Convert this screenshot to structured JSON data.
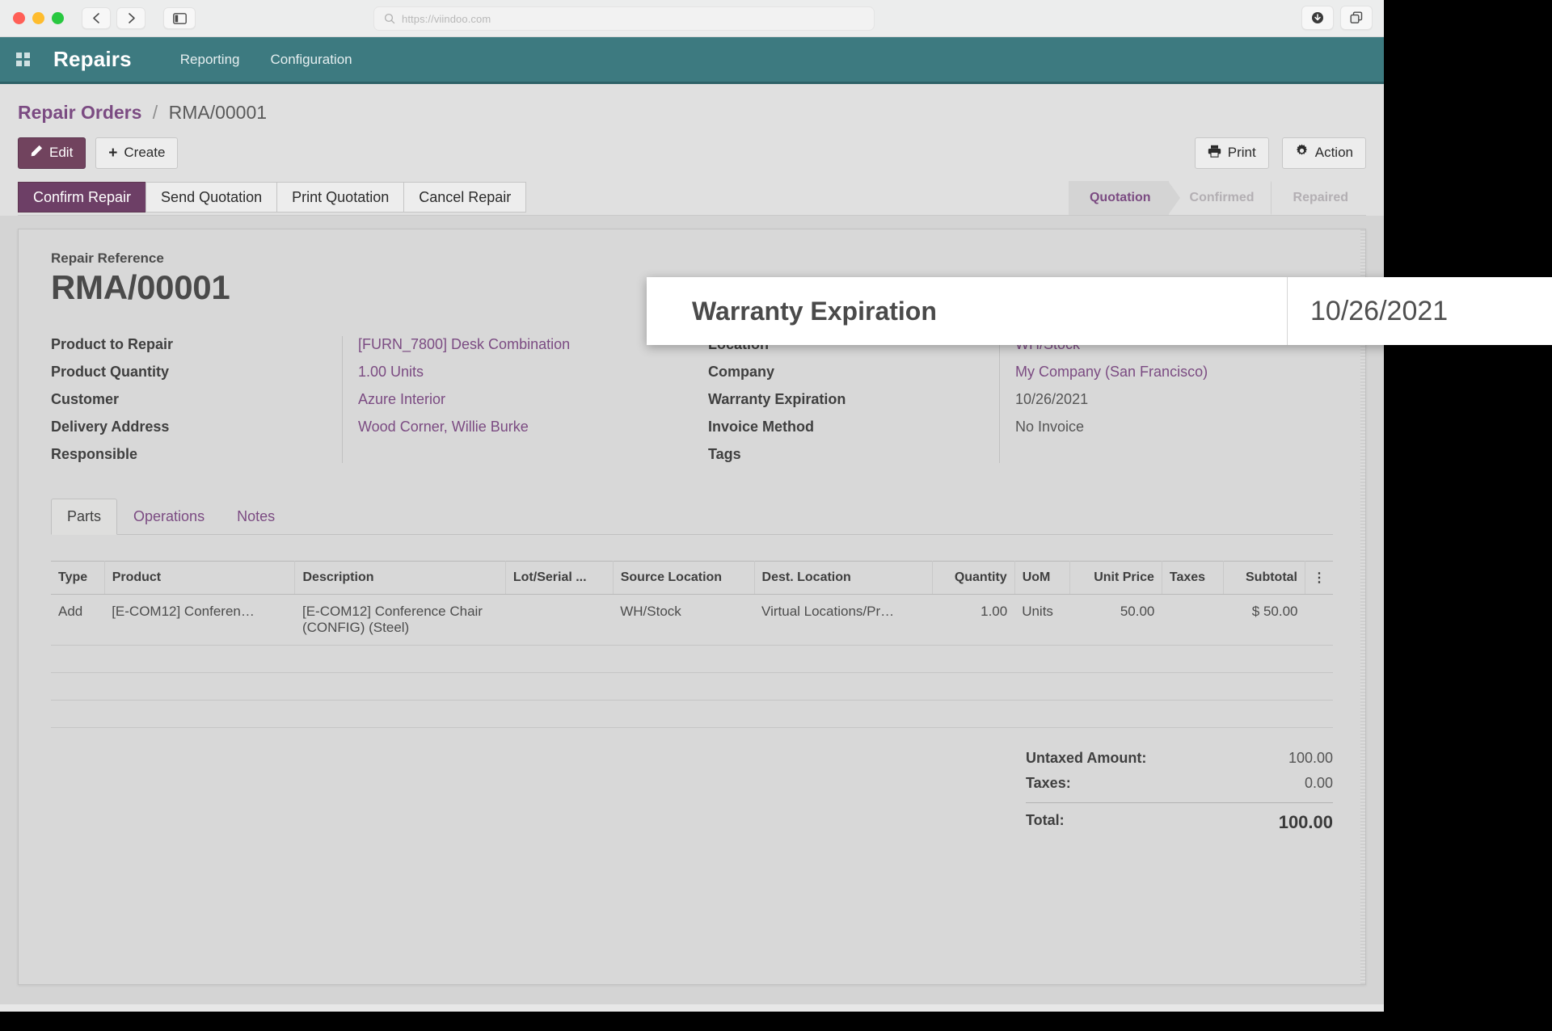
{
  "browser": {
    "url": "https://viindoo.com",
    "search_icon": "search-icon",
    "back_icon": "‹",
    "forward_icon": "›",
    "sidebar_icon": "sidebar-icon",
    "download_icon": "download-icon",
    "tabs_icon": "duplicate-tabs-icon"
  },
  "navbar": {
    "brand": "Repairs",
    "apps_icon": "apps-grid-icon",
    "menu": [
      {
        "label": "Reporting"
      },
      {
        "label": "Configuration"
      }
    ]
  },
  "control_panel": {
    "breadcrumb_root": "Repair Orders",
    "breadcrumb_sep": "/",
    "breadcrumb_current": "RMA/00001",
    "edit_label": "Edit",
    "edit_icon": "pencil-icon",
    "create_label": "Create",
    "create_icon": "plus-icon",
    "print_label": "Print",
    "print_icon": "printer-icon",
    "action_label": "Action",
    "action_icon": "gear-icon"
  },
  "statusbar": {
    "buttons": [
      {
        "label": "Confirm Repair",
        "active": true
      },
      {
        "label": "Send Quotation",
        "active": false
      },
      {
        "label": "Print Quotation",
        "active": false
      },
      {
        "label": "Cancel Repair",
        "active": false
      }
    ],
    "stages": [
      {
        "label": "Quotation",
        "active": true
      },
      {
        "label": "Confirmed",
        "active": false
      },
      {
        "label": "Repaired",
        "active": false
      }
    ]
  },
  "form": {
    "reference_label": "Repair Reference",
    "reference_value": "RMA/00001",
    "left_fields": [
      {
        "label": "Product to Repair",
        "value": "[FURN_7800] Desk Combination",
        "link": true
      },
      {
        "label": "Product Quantity",
        "value": "1.00 Units",
        "link": true
      },
      {
        "label": "Customer",
        "value": "Azure Interior",
        "link": true
      },
      {
        "label": "Delivery Address",
        "value": "Wood Corner, Willie Burke",
        "link": true
      },
      {
        "label": "Responsible",
        "value": "",
        "link": false
      }
    ],
    "right_fields": [
      {
        "label": "Location",
        "value": "WH/Stock",
        "link": true
      },
      {
        "label": "Company",
        "value": "My Company (San Francisco)",
        "link": true
      },
      {
        "label": "Warranty Expiration",
        "value": "10/26/2021",
        "link": false
      },
      {
        "label": "Invoice Method",
        "value": "No Invoice",
        "link": false
      },
      {
        "label": "Tags",
        "value": "",
        "link": false
      }
    ]
  },
  "notebook": {
    "tabs": [
      {
        "label": "Parts",
        "active": true
      },
      {
        "label": "Operations",
        "active": false
      },
      {
        "label": "Notes",
        "active": false
      }
    ]
  },
  "lines_table": {
    "columns": [
      {
        "label": "Type",
        "align": "left"
      },
      {
        "label": "Product",
        "align": "left"
      },
      {
        "label": "Description",
        "align": "left"
      },
      {
        "label": "Lot/Serial ...",
        "align": "left"
      },
      {
        "label": "Source Location",
        "align": "left"
      },
      {
        "label": "Dest. Location",
        "align": "left"
      },
      {
        "label": "Quantity",
        "align": "right"
      },
      {
        "label": "UoM",
        "align": "left"
      },
      {
        "label": "Unit Price",
        "align": "right"
      },
      {
        "label": "Taxes",
        "align": "left"
      },
      {
        "label": "Subtotal",
        "align": "right"
      }
    ],
    "options_icon": "vertical-dots-icon",
    "rows": [
      {
        "type": "Add",
        "product": "[E-COM12] Conferen…",
        "description": "[E-COM12] Conference Chair (CONFIG) (Steel)",
        "lot_serial": "",
        "source_location": "WH/Stock",
        "dest_location": "Virtual Locations/Pr…",
        "quantity": "1.00",
        "uom": "Units",
        "unit_price": "50.00",
        "taxes": "",
        "subtotal": "$ 50.00"
      }
    ]
  },
  "totals": {
    "untaxed_label": "Untaxed Amount:",
    "untaxed_value": "100.00",
    "taxes_label": "Taxes:",
    "taxes_value": "0.00",
    "total_label": "Total:",
    "total_value": "100.00"
  },
  "magnifier": {
    "label": "Warranty Expiration",
    "value": "10/26/2021"
  },
  "colors": {
    "navbar": "#3d7a80",
    "accent_purple": "#7b4b82",
    "button_purple": "#6d3f66"
  }
}
